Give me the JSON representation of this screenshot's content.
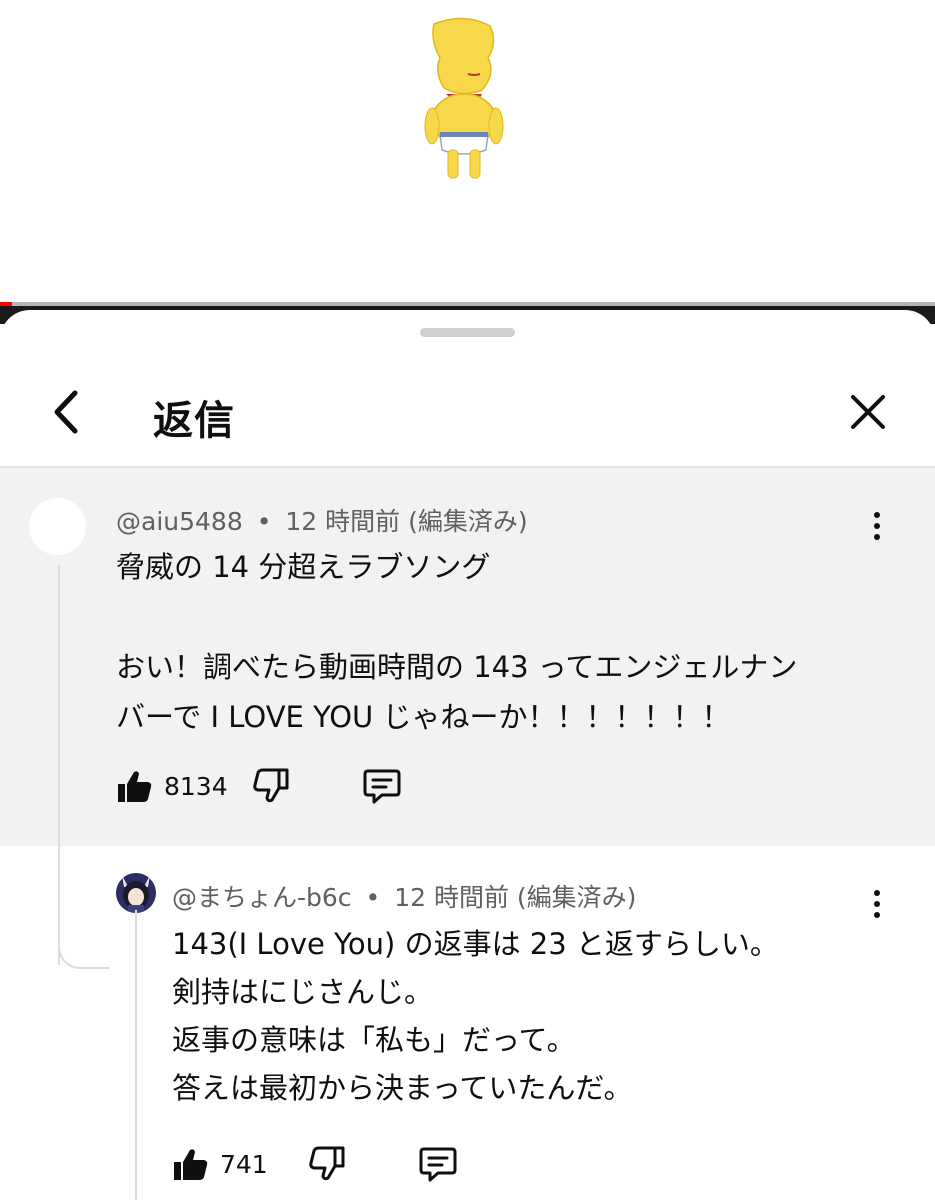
{
  "video": {
    "character_icon": "yellow-cartoon-character",
    "progress_color": "#ff0000"
  },
  "header": {
    "title": "返信",
    "back_icon": "chevron-left-icon",
    "close_icon": "close-icon"
  },
  "parent_comment": {
    "author": "@aiu5488",
    "separator": "•",
    "time": "12 時間前 (編集済み)",
    "lines": [
      "脅威の 14 分超えラブソング",
      "",
      "おい！調べたら動画時間の 143 ってエンジェルナン",
      "バーで I LOVE YOU じゃねーか！！！！！！！"
    ],
    "like_count": "8134",
    "background": "#f2f2f2"
  },
  "reply_comment": {
    "author": "@まちょん-b6c",
    "separator": "•",
    "time": "12 時間前 (編集済み)",
    "lines": [
      "143(I Love You) の返事は 23 と返すらしい。",
      "剣持はにじさんじ。",
      "返事の意味は「私も」だって。",
      "答えは最初から決まっていたんだ。"
    ],
    "like_count": "741"
  }
}
